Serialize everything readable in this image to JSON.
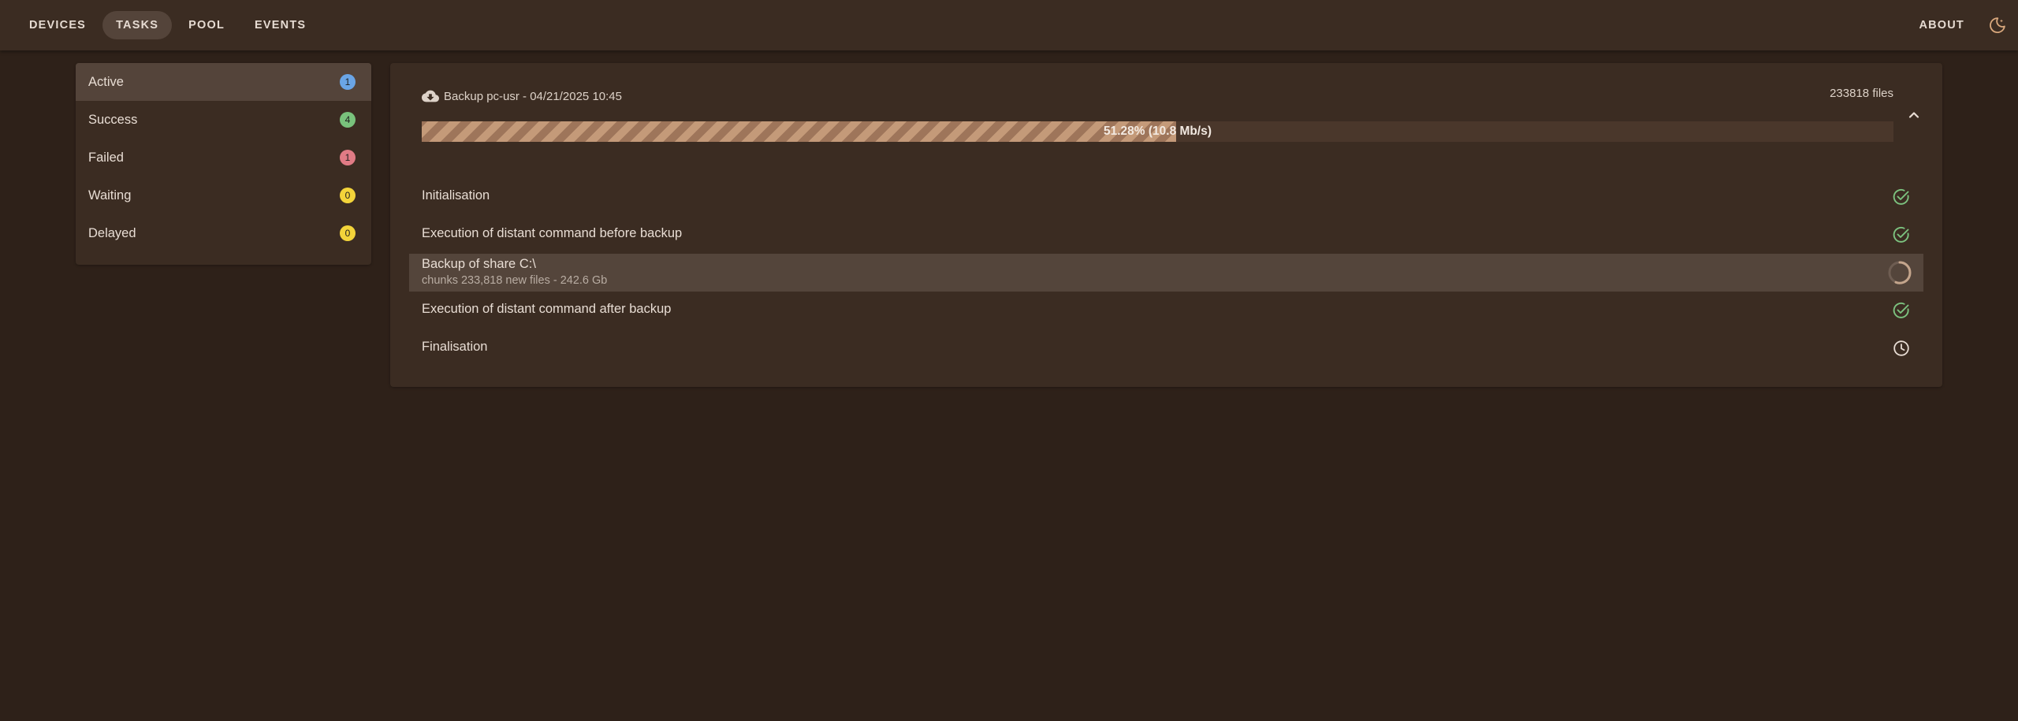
{
  "nav": {
    "items": [
      {
        "label": "DEVICES",
        "active": false
      },
      {
        "label": "TASKS",
        "active": true
      },
      {
        "label": "POOL",
        "active": false
      },
      {
        "label": "EVENTS",
        "active": false
      }
    ],
    "about": "ABOUT",
    "theme_icon": "moon-icon"
  },
  "sidebar": {
    "items": [
      {
        "label": "Active",
        "count": "1",
        "color": "#6aa5e6",
        "active": true
      },
      {
        "label": "Success",
        "count": "4",
        "color": "#79c27c",
        "active": false
      },
      {
        "label": "Failed",
        "count": "1",
        "color": "#e07b85",
        "active": false
      },
      {
        "label": "Waiting",
        "count": "0",
        "color": "#f3d43a",
        "active": false
      },
      {
        "label": "Delayed",
        "count": "0",
        "color": "#f3d43a",
        "active": false
      }
    ]
  },
  "task": {
    "icon": "cloud-download-icon",
    "title": "Backup pc-usr - 04/21/2025 10:45",
    "files": "233818 files",
    "progress_percent": 51.28,
    "progress_label": "51.28% (10.8 Mb/s)",
    "collapse_icon": "chevron-up-icon",
    "steps": [
      {
        "title": "Initialisation",
        "subtitle": "",
        "status": "done"
      },
      {
        "title": "Execution of distant command before backup",
        "subtitle": "",
        "status": "done"
      },
      {
        "title": "Backup of share C:\\",
        "subtitle": "chunks 233,818 new files - 242.6 Gb",
        "status": "running"
      },
      {
        "title": "Execution of distant command after backup",
        "subtitle": "",
        "status": "done"
      },
      {
        "title": "Finalisation",
        "subtitle": "",
        "status": "pending"
      }
    ]
  },
  "colors": {
    "success": "#7cc27f",
    "accent": "#c49a79",
    "background": "#2e2119",
    "surface": "#3b2c22"
  }
}
